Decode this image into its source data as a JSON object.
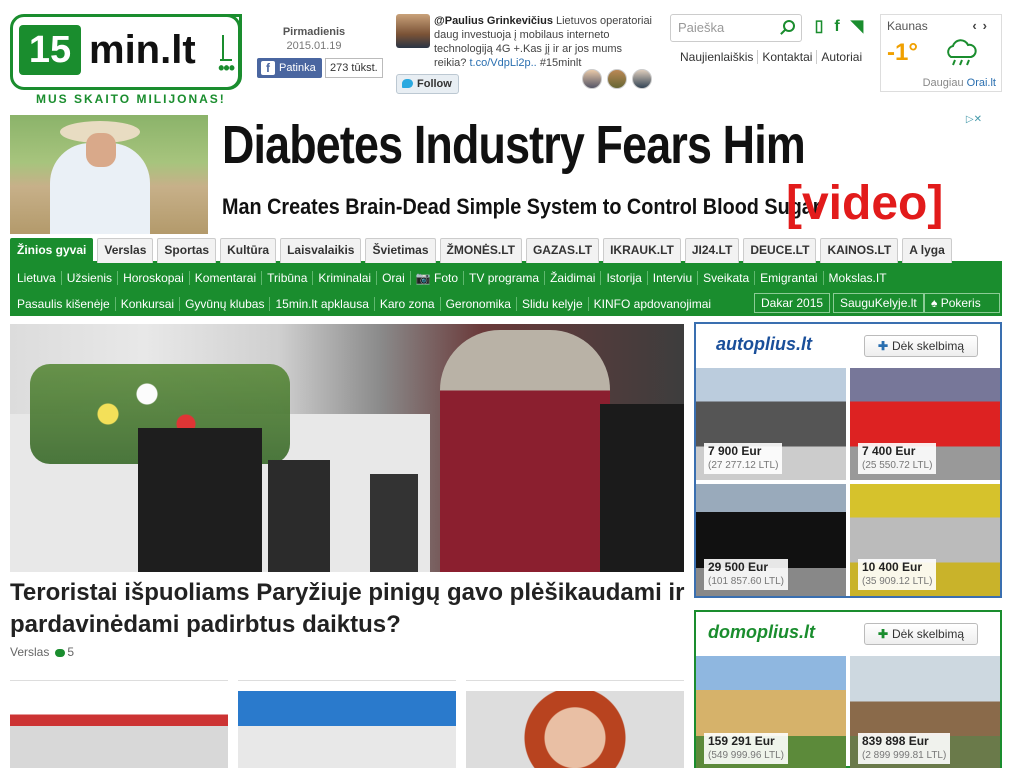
{
  "header": {
    "logo_num": "15",
    "logo_text": "min.lt",
    "slogan": "MUS SKAITO MILIJONAS!",
    "day": "Pirmadienis",
    "date": "2015.01.19",
    "fb_like": "Patinka",
    "fb_count": "273 tūkst.",
    "tweet": {
      "author": "@Paulius Grinkevičius",
      "text": "Lietuvos operatoriai daug investuoja į mobilaus interneto technologiją 4G +.Kas jį ir ar jos mums reikia?",
      "link": "t.co/VdpLi2p..",
      "tag": "#15minlt"
    },
    "follow": "Follow",
    "search_placeholder": "Paieška",
    "links": [
      "Naujienlaiškis",
      "Kontaktai",
      "Autoriai"
    ],
    "weather": {
      "city": "Kaunas",
      "temp": "-1°",
      "more": "Daugiau",
      "source": "Orai.lt"
    }
  },
  "ad": {
    "title": "Diabetes Industry Fears Him",
    "subtitle": "Man Creates Brain-Dead Simple System to Control Blood Sugar",
    "video": "[video]"
  },
  "nav": {
    "tabs": [
      "Žinios gyvai",
      "Verslas",
      "Sportas",
      "Kultūra",
      "Laisvalaikis",
      "Švietimas",
      "ŽMONĖS.LT",
      "GAZAS.LT",
      "IKRAUK.LT",
      "JI24.LT",
      "DEUCE.LT",
      "KAINOS.LT",
      "A lyga"
    ],
    "row1": [
      "Lietuva",
      "Užsienis",
      "Horoskopai",
      "Komentarai",
      "Tribūna",
      "Kriminalai",
      "Orai",
      "📷 Foto",
      "TV programa",
      "Žaidimai",
      "Istorija",
      "Interviu",
      "Sveikata",
      "Emigrantai",
      "Mokslas.IT"
    ],
    "row2": [
      "Pasaulis kišenėje",
      "Konkursai",
      "Gyvūnų klubas",
      "15min.lt apklausa",
      "Karo zona",
      "Geronomika",
      "Slidu kelyje",
      "KINFO apdovanojimai"
    ],
    "buttons": [
      "Dakar 2015",
      "SauguKelyje.lt",
      "♠ Pokeris"
    ]
  },
  "main": {
    "headline": "Teroristai išpuoliams Paryžiuje pinigų gavo plėšikaudami ir pardavinėdami padirbtus daiktus?",
    "category": "Verslas",
    "comments": "5"
  },
  "autoplius": {
    "logo": "autoplius.lt",
    "add": "Dėk skelbimą",
    "items": [
      {
        "price": "7 900 Eur",
        "ltl": "(27 277.12 LTL)"
      },
      {
        "price": "7 400 Eur",
        "ltl": "(25 550.72 LTL)"
      },
      {
        "price": "29 500 Eur",
        "ltl": "(101 857.60 LTL)"
      },
      {
        "price": "10 400 Eur",
        "ltl": "(35 909.12 LTL)"
      }
    ]
  },
  "domoplius": {
    "logo": "domoplius.lt",
    "add": "Dėk skelbimą",
    "items": [
      {
        "price": "159 291 Eur",
        "ltl": "(549 999.96 LTL)"
      },
      {
        "price": "839 898 Eur",
        "ltl": "(2 899 999.81 LTL)"
      }
    ]
  },
  "colors": {
    "brand": "#1a8d2e",
    "auto": "#3a6fb0",
    "ad_red": "#e21b1b"
  }
}
